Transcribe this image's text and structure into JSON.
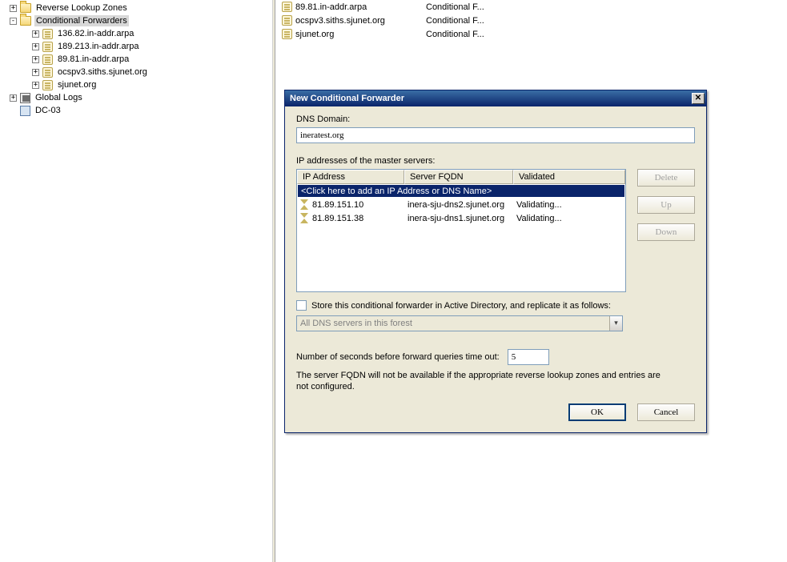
{
  "tree": {
    "reverse_lookup_zones": "Reverse Lookup Zones",
    "conditional_forwarders": "Conditional Forwarders",
    "cf_items": [
      "136.82.in-addr.arpa",
      "189.213.in-addr.arpa",
      "89.81.in-addr.arpa",
      "ocspv3.siths.sjunet.org",
      "sjunet.org"
    ],
    "global_logs": "Global Logs",
    "server": "DC-03"
  },
  "list": {
    "rows": [
      {
        "name": "89.81.in-addr.arpa",
        "type": "Conditional F..."
      },
      {
        "name": "ocspv3.siths.sjunet.org",
        "type": "Conditional F..."
      },
      {
        "name": "sjunet.org",
        "type": "Conditional F..."
      }
    ]
  },
  "dialog": {
    "title": "New Conditional Forwarder",
    "dns_domain_label": "DNS Domain:",
    "dns_domain_value": "ineratest.org",
    "masters_label": "IP addresses of the master servers:",
    "grid_headers": {
      "ip": "IP Address",
      "fqdn": "Server FQDN",
      "val": "Validated"
    },
    "add_row_text": "<Click here to add an IP Address or DNS Name>",
    "rows": [
      {
        "ip": "81.89.151.10",
        "fqdn": "inera-sju-dns2.sjunet.org",
        "val": "Validating..."
      },
      {
        "ip": "81.89.151.38",
        "fqdn": "inera-sju-dns1.sjunet.org",
        "val": "Validating..."
      }
    ],
    "buttons": {
      "delete": "Delete",
      "up": "Up",
      "down": "Down",
      "ok": "OK",
      "cancel": "Cancel"
    },
    "store_label": "Store this conditional forwarder in Active Directory, and replicate it as follows:",
    "combo_value": "All DNS servers in this forest",
    "timeout_label": "Number of seconds before forward queries time out:",
    "timeout_value": "5",
    "note": "The server FQDN will not be available if the appropriate reverse lookup zones and entries are not configured."
  }
}
